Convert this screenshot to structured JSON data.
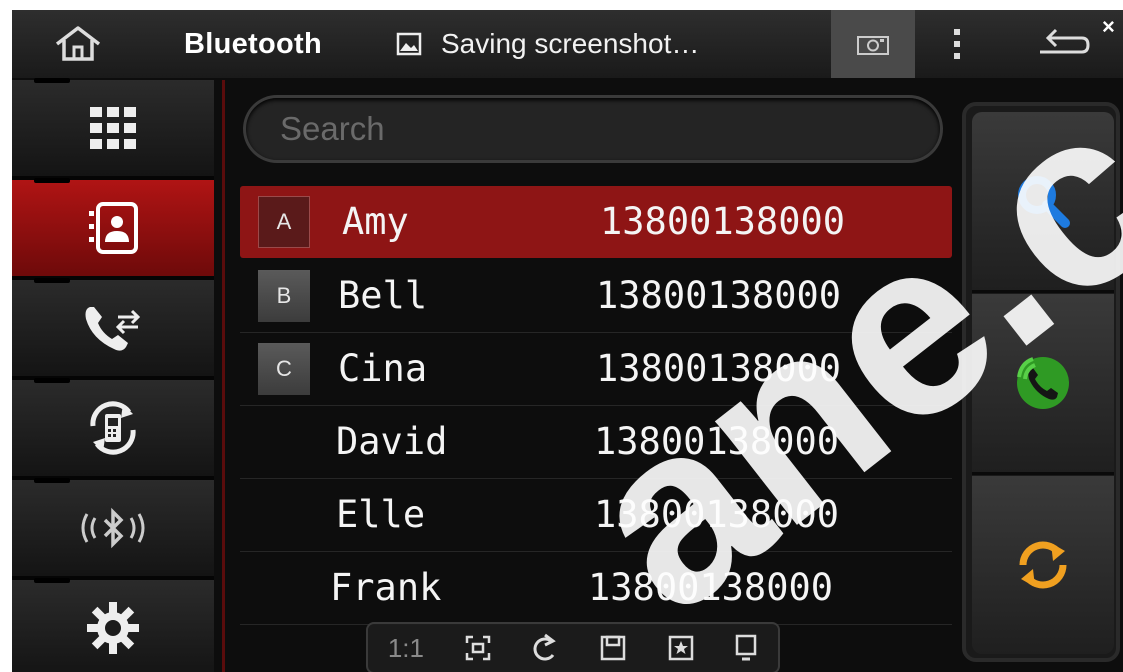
{
  "status_bar": {
    "app_title": "Bluetooth",
    "notification_text": "Saving screenshot…",
    "close_symbol": "×",
    "icons": [
      "home-icon",
      "image-icon",
      "camera-icon",
      "overflow-menu-icon",
      "back-icon"
    ]
  },
  "sidebar": {
    "items": [
      {
        "icon": "dialpad-icon",
        "active": false
      },
      {
        "icon": "contacts-icon",
        "active": true
      },
      {
        "icon": "call-log-icon",
        "active": false
      },
      {
        "icon": "phone-sync-icon",
        "active": false
      },
      {
        "icon": "bluetooth-icon",
        "active": false
      },
      {
        "icon": "settings-gear-icon",
        "active": false
      }
    ]
  },
  "search": {
    "placeholder": "Search",
    "value": ""
  },
  "contacts": [
    {
      "letter": "A",
      "name": "Amy",
      "number": "13800138000",
      "selected": true
    },
    {
      "letter": "B",
      "name": "Bell",
      "number": "13800138000",
      "selected": false
    },
    {
      "letter": "C",
      "name": "Cina",
      "number": "13800138000",
      "selected": false
    },
    {
      "letter": "",
      "name": "David",
      "number": "13800138000",
      "selected": false
    },
    {
      "letter": "",
      "name": "Elle",
      "number": "13800138000",
      "selected": false
    },
    {
      "letter": "",
      "name": "Frank",
      "number": "13800138000",
      "selected": false
    }
  ],
  "right_panel": {
    "buttons": [
      "search-icon",
      "call-icon",
      "sync-icon"
    ]
  },
  "screenshot_toolbar": {
    "ratio_label": "1:1",
    "icons": [
      "crop-icon",
      "rotate-icon",
      "save-icon",
      "favorite-icon",
      "device-icon"
    ]
  },
  "watermark": {
    "text": "ane.cor"
  },
  "colors": {
    "accent_red": "#8e1515",
    "search_blue": "#1e7be0",
    "call_green": "#3cb52a",
    "sync_orange": "#f0a020"
  }
}
